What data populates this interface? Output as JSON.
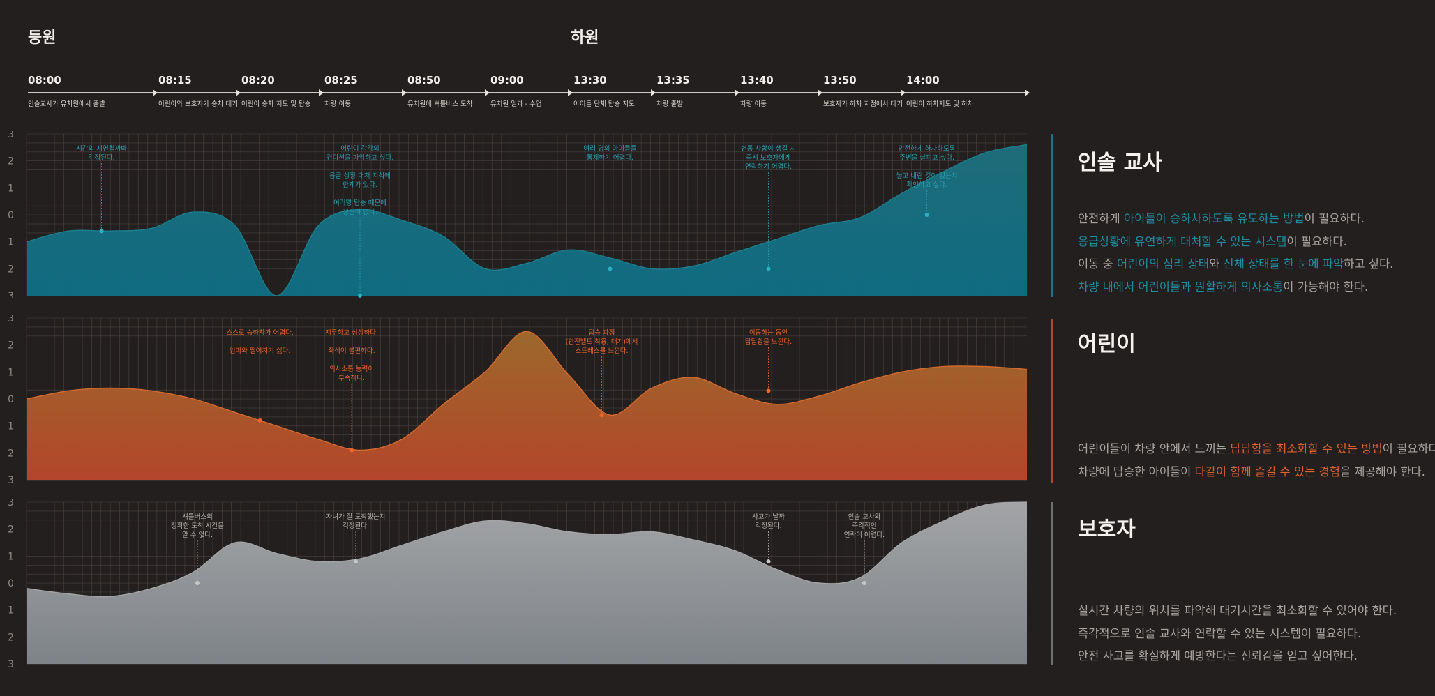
{
  "phases": {
    "morning": "등원",
    "afternoon": "하원"
  },
  "timeline": [
    {
      "time": "08:00",
      "event": "인솔교사가 유치원에서 출발"
    },
    {
      "time": "08:15",
      "event": "어린이와 보호자가 승차 대기"
    },
    {
      "time": "08:20",
      "event": "어린이 승차 지도 및 탑승"
    },
    {
      "time": "08:25",
      "event": "차량 이동"
    },
    {
      "time": "08:50",
      "event": "유치원에 셔틀버스 도착"
    },
    {
      "time": "09:00",
      "event": "유치원 일과 - 수업"
    },
    {
      "time": "13:30",
      "event": "아이들 단체 탑승 지도"
    },
    {
      "time": "13:35",
      "event": "차량 출발"
    },
    {
      "time": "13:40",
      "event": "차량 이동"
    },
    {
      "time": "13:50",
      "event": "보호자가 하차 지점에서 대기"
    },
    {
      "time": "14:00",
      "event": "어린이 하차지도 및 하차"
    }
  ],
  "chart_data": [
    {
      "type": "area",
      "series": [
        {
          "name": "인솔 교사"
        }
      ],
      "color": "#13748a",
      "ylim": [
        -3,
        3
      ],
      "y_ticks": [
        "3",
        "2",
        "1",
        "0",
        "1",
        "2",
        "3"
      ],
      "x": [
        0,
        0.5,
        1,
        1.5,
        2,
        2.5,
        3,
        3.5,
        4,
        4.5,
        5,
        5.5,
        6,
        6.5,
        7,
        7.5,
        8,
        8.5,
        9,
        9.5,
        10,
        10.5,
        11,
        11.5,
        12
      ],
      "values": [
        -1.0,
        -0.6,
        -0.6,
        -0.5,
        0.1,
        -0.4,
        -3.0,
        -0.4,
        0.2,
        -0.2,
        -0.8,
        -2.0,
        -1.8,
        -1.3,
        -1.6,
        -2.0,
        -1.9,
        -1.4,
        -0.9,
        -0.4,
        -0.1,
        0.8,
        1.6,
        2.3,
        2.6
      ],
      "annotations": [
        {
          "x": 0.9,
          "y": -0.6,
          "lines": [
            "시간의 지연될까봐",
            "걱정된다."
          ]
        },
        {
          "x": 4.0,
          "y": -3.0,
          "lines": [
            "어린이 각각의",
            "컨디션을 파악하고 싶다.",
            "",
            "응급 상황 대처 지식에",
            "한계가 있다.",
            "",
            "여러명 탑승 때문에",
            "정신이 없다."
          ]
        },
        {
          "x": 7.0,
          "y": -2.0,
          "lines": [
            "여러 명의 아이들을",
            "통제하기 어렵다."
          ]
        },
        {
          "x": 8.9,
          "y": -2.0,
          "lines": [
            "변동 사항이 생길 시",
            "즉시 보호자에게",
            "연락하기 어렵다."
          ]
        },
        {
          "x": 10.8,
          "y": 0.0,
          "lines": [
            "안전하게 하차하도록",
            "주변을 살피고 싶다.",
            "",
            "놓고 내린 것이 없는지",
            "확인하고 싶다."
          ]
        }
      ]
    },
    {
      "type": "area",
      "series": [
        {
          "name": "어린이"
        }
      ],
      "color": "#b44a27",
      "ylim": [
        -3,
        3
      ],
      "y_ticks": [
        "3",
        "2",
        "1",
        "0",
        "1",
        "2",
        "3"
      ],
      "x": [
        0,
        0.5,
        1,
        1.5,
        2,
        2.5,
        3,
        3.5,
        4,
        4.5,
        5,
        5.5,
        6,
        6.5,
        7,
        7.5,
        8,
        8.5,
        9,
        9.5,
        10,
        10.5,
        11,
        11.5,
        12
      ],
      "values": [
        0.0,
        0.3,
        0.4,
        0.3,
        0.0,
        -0.5,
        -1.0,
        -1.5,
        -1.9,
        -1.5,
        -0.2,
        1.0,
        2.5,
        0.9,
        -0.6,
        0.4,
        0.8,
        0.2,
        -0.2,
        0.1,
        0.6,
        1.0,
        1.2,
        1.2,
        1.1
      ],
      "annotations": [
        {
          "x": 2.8,
          "y": -0.8,
          "lines": [
            "스스로 승하차가 어렵다.",
            "",
            "엄마와 떨어지기 싫다."
          ]
        },
        {
          "x": 3.9,
          "y": -1.9,
          "lines": [
            "지루하고 심심하다.",
            "",
            "좌석이 불편하다.",
            "",
            "의사소통 능력이",
            "부족하다."
          ]
        },
        {
          "x": 6.9,
          "y": -0.6,
          "lines": [
            "탑승 과정",
            "(안전벨트 착용, 대기)에서",
            "스트레스를 느낀다."
          ]
        },
        {
          "x": 8.9,
          "y": 0.3,
          "lines": [
            "이동하는 동안",
            "답답함을 느낀다."
          ]
        }
      ]
    },
    {
      "type": "area",
      "series": [
        {
          "name": "보호자"
        }
      ],
      "color": "#8f9295",
      "ylim": [
        -3,
        3
      ],
      "y_ticks": [
        "3",
        "2",
        "1",
        "0",
        "1",
        "2",
        "3"
      ],
      "x": [
        0,
        0.5,
        1,
        1.5,
        2,
        2.5,
        3,
        3.5,
        4,
        4.5,
        5,
        5.5,
        6,
        6.5,
        7,
        7.5,
        8,
        8.5,
        9,
        9.5,
        10,
        10.5,
        11,
        11.5,
        12
      ],
      "values": [
        -0.2,
        -0.4,
        -0.5,
        -0.2,
        0.4,
        1.5,
        1.1,
        0.8,
        0.9,
        1.4,
        1.9,
        2.3,
        2.2,
        1.9,
        1.8,
        1.9,
        1.6,
        1.2,
        0.5,
        0.0,
        0.2,
        1.5,
        2.3,
        2.9,
        3.0
      ],
      "annotations": [
        {
          "x": 2.05,
          "y": 0.0,
          "lines": [
            "셔틀버스의",
            "정확한 도착 시간을",
            "알 수 없다."
          ]
        },
        {
          "x": 3.95,
          "y": 0.8,
          "lines": [
            "자녀가 잘 도착했는지",
            "걱정된다."
          ]
        },
        {
          "x": 8.9,
          "y": 0.8,
          "lines": [
            "사고가 날까",
            "걱정된다."
          ]
        },
        {
          "x": 10.05,
          "y": 0.0,
          "lines": [
            "인솔 교사와",
            "즉각적인",
            "연락이 어렵다."
          ]
        }
      ]
    }
  ],
  "panels": [
    {
      "title": "인솔 교사",
      "accent": "#13748a",
      "lines": [
        [
          {
            "t": "안전하게 "
          },
          {
            "t": "아이들이 승하차하도록 유도하는 방법",
            "hl": true
          },
          {
            "t": "이 필요하다."
          }
        ],
        [
          {
            "t": "응급상황에 유연하게 대처할 수 있는 시스템",
            "hl": true
          },
          {
            "t": "이 필요하다."
          }
        ],
        [
          {
            "t": "이동 중 "
          },
          {
            "t": "어린이의 심리 상태",
            "hl": true
          },
          {
            "t": "와 "
          },
          {
            "t": "신체 상태를 한 눈에 파악",
            "hl": true
          },
          {
            "t": "하고 싶다."
          }
        ],
        [
          {
            "t": "차량 내에서 어린이들과 원활하게 의사소통",
            "hl": true
          },
          {
            "t": "이 가능해야 한다."
          }
        ]
      ]
    },
    {
      "title": "어린이",
      "accent": "#b44a27",
      "lines": [
        [
          {
            "t": "어린이들이 차량 안에서 느끼는 "
          },
          {
            "t": "답답함을 최소화할 수 있는 방법",
            "hl": true
          },
          {
            "t": "이 필요하다."
          }
        ],
        [
          {
            "t": "차량에 탑승한 아이들이 "
          },
          {
            "t": "다같이 함께 즐길 수 있는 경험",
            "hl": true
          },
          {
            "t": "을 제공해야 한다."
          }
        ]
      ]
    },
    {
      "title": "보호자",
      "accent": "#6e6f70",
      "lines": [
        [
          {
            "t": "실시간 차량의 위치를 파악해 대기시간을 최소화할 수 있어야 한다."
          }
        ],
        [
          {
            "t": "즉각적으로 인솔 교사와 연락할 수 있는 시스템이 필요하다."
          }
        ],
        [
          {
            "t": "안전 사고를 확실하게 예방한다는 신뢰감을 얻고 싶어한다."
          }
        ]
      ]
    }
  ],
  "colors": {
    "background": "#231f1e",
    "teal": "#13748a",
    "teal_text": "#1c8fa3",
    "orange": "#b44a27",
    "orange_text": "#e0602e",
    "gray": "#8f9295"
  }
}
